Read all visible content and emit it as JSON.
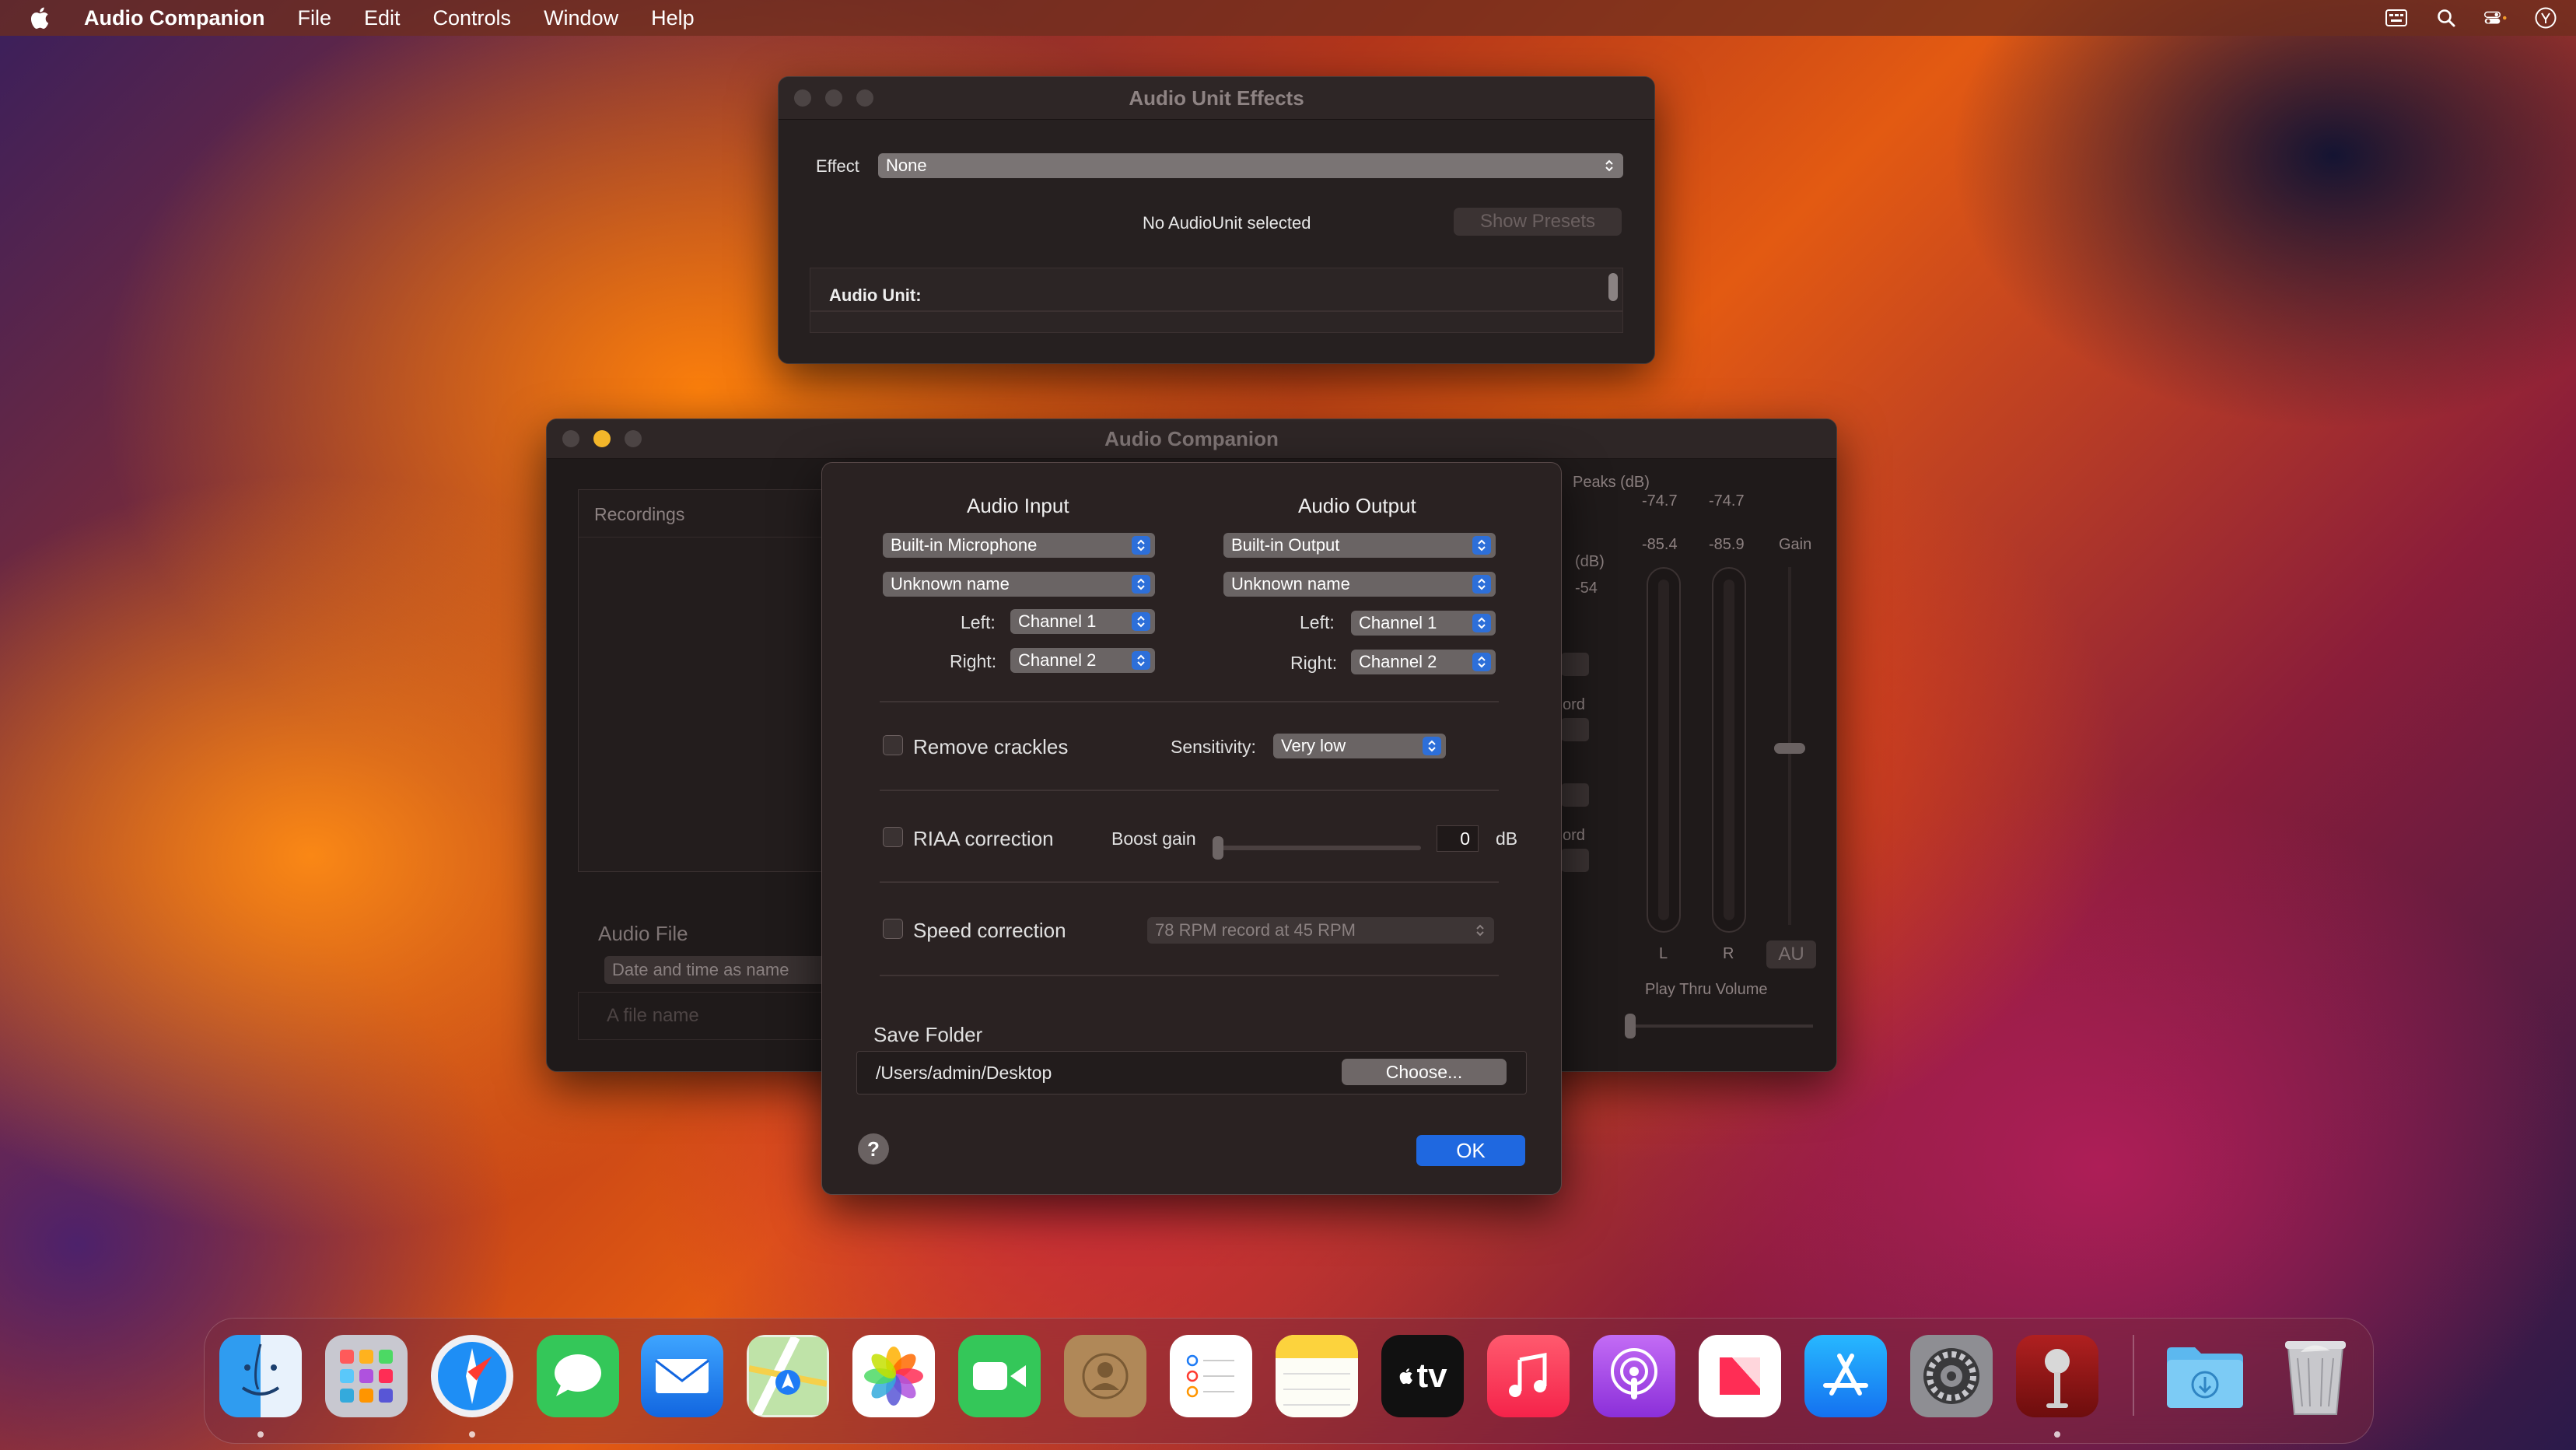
{
  "menubar": {
    "app_name": "Audio Companion",
    "items": [
      "File",
      "Edit",
      "Controls",
      "Window",
      "Help"
    ],
    "right_icons": [
      "input-menu-icon",
      "spotlight-search-icon",
      "control-center-icon",
      "user-icon"
    ]
  },
  "effects_window": {
    "title": "Audio Unit Effects",
    "effect_label": "Effect",
    "effect_value": "None",
    "status": "No AudioUnit selected",
    "show_presets": "Show Presets",
    "audio_unit_label": "Audio Unit:"
  },
  "main_window": {
    "title": "Audio Companion",
    "recordings_label": "Recordings",
    "audio_file_label": "Audio File",
    "naming_option": "Date and time as name",
    "file_name_placeholder": "A file name",
    "peaks_label": "Peaks (dB)",
    "peak_left": "-74.7",
    "peak_right": "-74.7",
    "level_left": "-85.4",
    "level_right": "-85.9",
    "gain_label": "Gain",
    "db_label": "(dB)",
    "db_value": "-54",
    "partial_label_1": "ord",
    "partial_label_2": "ord",
    "channel_l": "L",
    "channel_r": "R",
    "au_button": "AU",
    "play_thru_label": "Play Thru Volume"
  },
  "settings_sheet": {
    "audio_input_header": "Audio Input",
    "audio_output_header": "Audio Output",
    "input_device": "Built-in Microphone",
    "input_source": "Unknown name",
    "output_device": "Built-in Output",
    "output_source": "Unknown name",
    "left_label": "Left:",
    "right_label": "Right:",
    "input_left": "Channel 1",
    "input_right": "Channel 2",
    "output_left": "Channel 1",
    "output_right": "Channel 2",
    "remove_crackles": "Remove crackles",
    "sensitivity_label": "Sensitivity:",
    "sensitivity_value": "Very low",
    "riaa_correction": "RIAA correction",
    "boost_gain_label": "Boost gain",
    "boost_gain_value": "0",
    "boost_gain_unit": "dB",
    "speed_correction": "Speed correction",
    "speed_option": "78 RPM record at 45 RPM",
    "save_folder_label": "Save Folder",
    "save_folder_path": "/Users/admin/Desktop",
    "choose_button": "Choose...",
    "help_button": "?",
    "ok_button": "OK"
  },
  "dock": {
    "apps": [
      "Finder",
      "Launchpad",
      "Safari",
      "Messages",
      "Mail",
      "Maps",
      "Photos",
      "FaceTime",
      "Contacts",
      "Reminders",
      "Notes",
      "TV",
      "Music",
      "Podcasts",
      "News",
      "App Store",
      "System Settings",
      "Audio Companion",
      "Downloads",
      "Trash"
    ],
    "tv_label": "tv"
  }
}
